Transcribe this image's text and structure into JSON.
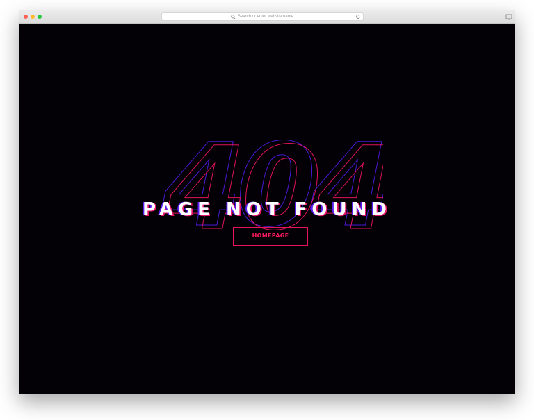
{
  "browser": {
    "address_placeholder": "Search or enter website name",
    "icons": {
      "search": "search-icon",
      "reload": "reload-icon",
      "tabs": "tabs-overview-icon"
    }
  },
  "page": {
    "background_number": "404",
    "headline": "PAGE NOT FOUND",
    "home_button_label": "HOMEPAGE"
  },
  "colors": {
    "background": "#030106",
    "accent_pink": "#e8135b",
    "accent_purple": "#5a1df0",
    "headline_text": "#ffffff"
  }
}
